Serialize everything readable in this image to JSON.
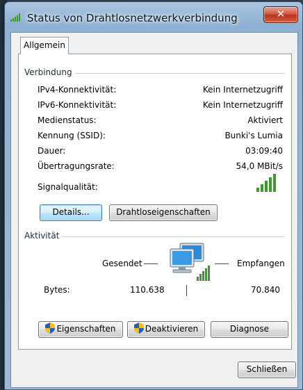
{
  "window": {
    "title": "Status von Drahtlosnetzwerkverbindung",
    "close_glyph": "✕"
  },
  "tab": {
    "label": "Allgemein"
  },
  "connection": {
    "section_title": "Verbindung",
    "rows": [
      {
        "label": "IPv4-Konnektivität:",
        "value": "Kein Internetzugriff"
      },
      {
        "label": "IPv6-Konnektivität:",
        "value": "Kein Internetzugriff"
      },
      {
        "label": "Medienstatus:",
        "value": "Aktiviert"
      },
      {
        "label": "Kennung (SSID):",
        "value": "Bunki's Lumia"
      },
      {
        "label": "Dauer:",
        "value": "03:09:40"
      },
      {
        "label": "Übertragungsrate:",
        "value": "54,0 MBit/s"
      }
    ],
    "signal_label": "Signalqualität:",
    "signal_bars_filled": 5,
    "signal_bars_total": 5,
    "details_button": "Details...",
    "wireless_props_button": "Drahtloseigenschaften"
  },
  "activity": {
    "section_title": "Aktivität",
    "sent_label": "Gesendet",
    "received_label": "Empfangen",
    "bytes_label": "Bytes:",
    "bytes_sent": "110.638",
    "bytes_received": "70.840"
  },
  "actions": {
    "properties_button": "Eigenschaften",
    "disable_button": "Deaktivieren",
    "diagnose_button": "Diagnose"
  },
  "footer": {
    "close_button": "Schließen"
  },
  "colors": {
    "signal_green": "#3a9a2a",
    "shield_blue": "#2a5fb0",
    "shield_yellow": "#f0c020"
  }
}
